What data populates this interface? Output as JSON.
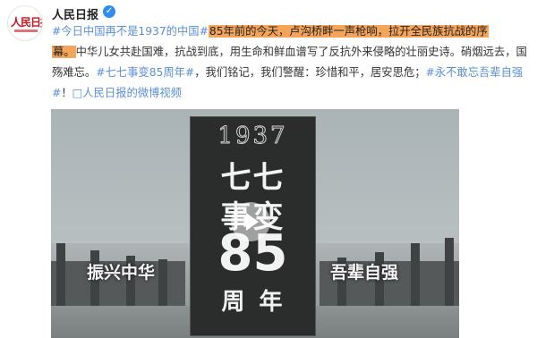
{
  "account": {
    "avatar_text": "人民日报",
    "avatar_sub": "PEOPLE'S DAILY",
    "name": "人民日报",
    "verified_mark": "✓"
  },
  "post": {
    "hashtag1": "#今日中国再不是1937的中国#",
    "highlight1": "85年前的今天，卢沟桥畔一声枪响，拉开全民族抗战的序",
    "highlight2": "幕。",
    "body1": "中华儿女共赴国难，抗战到底，用生命和鲜血谱写了反抗外来侵略的壮丽史诗。硝烟远去，国殇难忘。",
    "hashtag2": "#七七事变85周年#",
    "body2": "，我们铭记，我们警醒：珍惜和平，居安思危；",
    "hashtag3": "#永不敢忘吾辈自强#",
    "body3": "！",
    "video_link_icon": "□",
    "video_link": "人民日报的微博视频"
  },
  "video": {
    "poster_year": "1937",
    "poster_line1": "七七",
    "poster_line2": "事变",
    "poster_number": "85",
    "poster_suffix": "周年",
    "overlay_left": "振兴中华",
    "overlay_right": "吾辈自强"
  }
}
